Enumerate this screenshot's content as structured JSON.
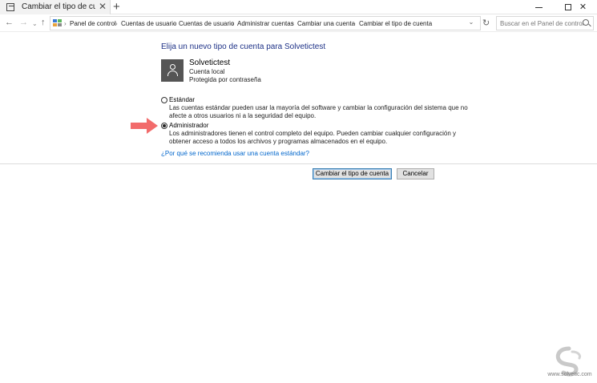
{
  "window": {
    "tab_title": "Cambiar el tipo de cuenta",
    "tab_close": "✕",
    "new_tab": "+",
    "close_glyph": "✕"
  },
  "nav": {
    "back": "←",
    "forward": "→",
    "history": "⌄",
    "up": "↑",
    "breadcrumbs": [
      "Panel de control",
      "Cuentas de usuario",
      "Cuentas de usuario",
      "Administrar cuentas",
      "Cambiar una cuenta",
      "Cambiar el tipo de cuenta"
    ],
    "separator": "›",
    "dropdown": "⌄",
    "refresh": "↻",
    "search_placeholder": "Buscar en el Panel de control"
  },
  "content": {
    "heading": "Elija un nuevo tipo de cuenta para Solvetictest",
    "user": {
      "name": "Solvetictest",
      "type": "Cuenta local",
      "protection": "Protegida por contraseña"
    },
    "options": [
      {
        "label": "Estándar",
        "selected": false,
        "desc_1": "Las cuentas estándar pueden usar la mayoría del software y cambiar la configuración del sistema que no",
        "desc_2": "afecte a otros usuarios ni a la seguridad del equipo."
      },
      {
        "label": "Administrador",
        "selected": true,
        "desc_1": "Los administradores tienen el control completo del equipo. Pueden cambiar cualquier configuración y",
        "desc_2": "obtener acceso a todos los archivos y programas almacenados en el equipo."
      }
    ],
    "help_link": "¿Por qué se recomienda usar una cuenta estándar?",
    "primary_button": "Cambiar el tipo de cuenta",
    "cancel_button": "Cancelar"
  },
  "watermark": {
    "text": "www.solvetic.com"
  },
  "colors": {
    "heading": "#1e3287",
    "link": "#0066cc",
    "avatar": "#555555",
    "arrow": "#f26b6b",
    "button_border_focus": "#3c7fb1"
  }
}
